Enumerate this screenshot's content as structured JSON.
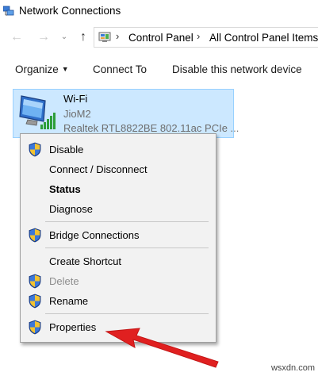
{
  "window": {
    "title": "Network Connections"
  },
  "address": {
    "breadcrumbs": [
      "Control Panel",
      "All Control Panel Items"
    ]
  },
  "toolbar": {
    "organize": "Organize",
    "connect_to": "Connect To",
    "disable_device": "Disable this network device"
  },
  "connection": {
    "name": "Wi-Fi",
    "ssid": "JioM2",
    "device": "Realtek RTL8822BE 802.11ac PCIe ..."
  },
  "menu": {
    "items": [
      {
        "label": "Disable",
        "shield": true
      },
      {
        "label": "Connect / Disconnect",
        "shield": false
      },
      {
        "label": "Status",
        "shield": false,
        "bold": true
      },
      {
        "label": "Diagnose",
        "shield": false
      },
      {
        "label": "Bridge Connections",
        "shield": true
      },
      {
        "label": "Create Shortcut",
        "shield": false
      },
      {
        "label": "Delete",
        "shield": true,
        "disabled": true
      },
      {
        "label": "Rename",
        "shield": true
      },
      {
        "label": "Properties",
        "shield": true
      }
    ]
  },
  "colors": {
    "selection": "#cce8ff",
    "arrow": "#e02020",
    "menu_bg": "#f2f2f2"
  },
  "watermark": "wsxdn.com"
}
